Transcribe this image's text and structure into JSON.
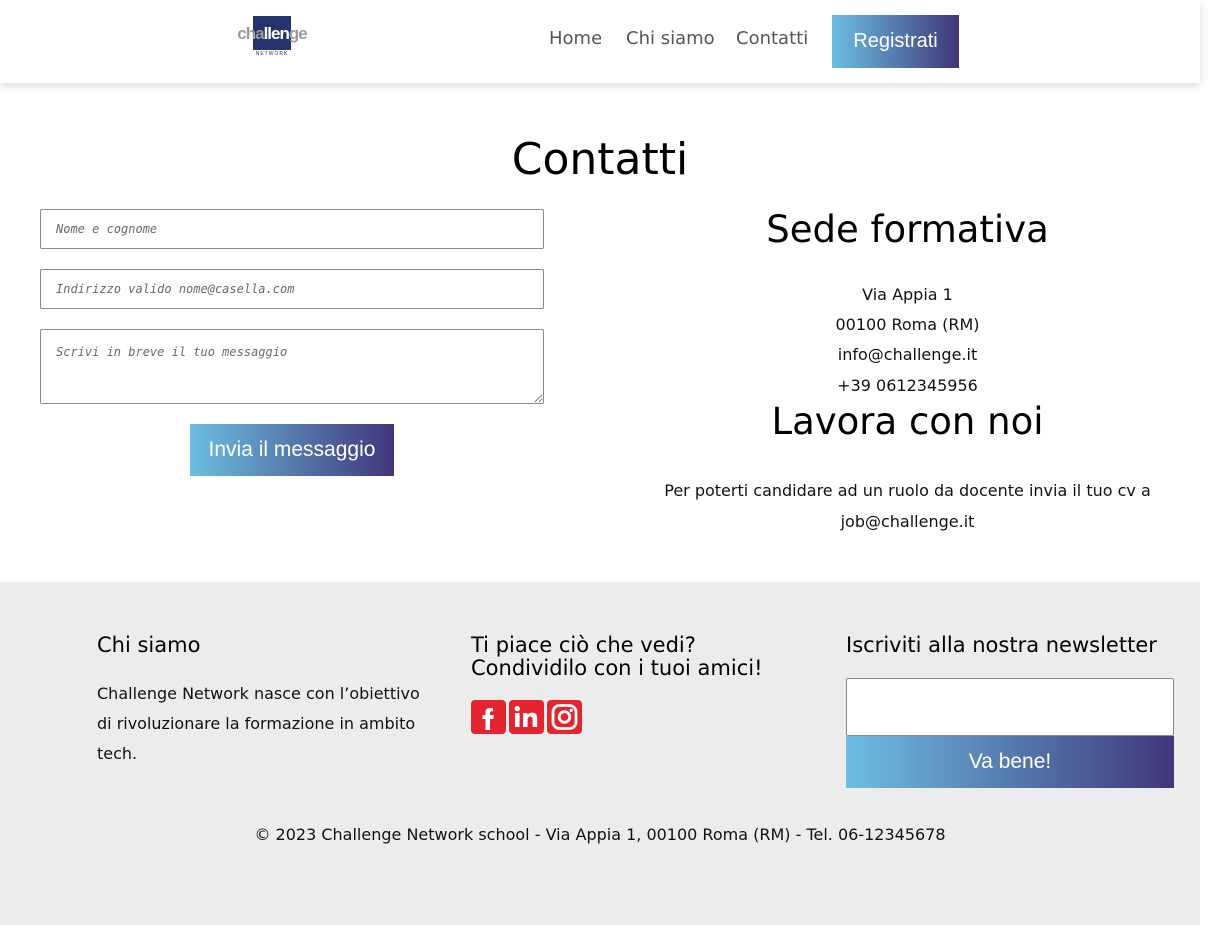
{
  "header": {
    "logo_word_before": "cha",
    "logo_word_box": "llen",
    "logo_word_after": "ge",
    "logo_sub": "NETWORK",
    "nav": [
      {
        "label": "Home"
      },
      {
        "label": "Chi siamo"
      },
      {
        "label": "Contatti"
      }
    ],
    "register_label": "Registrati"
  },
  "main": {
    "title": "Contatti",
    "form": {
      "name_placeholder": "Nome e cognome",
      "email_placeholder": "Indirizzo valido nome@casella.com",
      "message_placeholder": "Scrivi in breve il tuo messaggio",
      "submit_label": "Invia il messaggio"
    },
    "sede": {
      "title": "Sede formativa",
      "lines": [
        "Via Appia 1",
        "00100 Roma (RM)",
        "info@challenge.it",
        "+39 0612345956"
      ]
    },
    "lavora": {
      "title": "Lavora con noi",
      "text": "Per poterti candidare ad un ruolo da docente invia il tuo cv a job@challenge.it"
    }
  },
  "footer": {
    "chi_siamo": {
      "title": "Chi siamo",
      "text": "Challenge Network nasce con l’obiettivo di rivoluzionare la formazione in ambito tech."
    },
    "share": {
      "title_line1": "Ti piace ciò che vedi?",
      "title_line2": "Condividilo con i tuoi amici!",
      "icons": [
        "facebook-icon",
        "linkedin-icon",
        "instagram-icon"
      ]
    },
    "newsletter": {
      "title": "Iscriviti alla nostra newsletter",
      "input_value": "",
      "button_label": "Va bene!"
    },
    "copyright": "© 2023 Challenge Network school - Via Appia 1, 00100 Roma (RM) - Tel. 06-12345678"
  },
  "colors": {
    "brand_navy": "#24336b",
    "gradient_start": "#6cbfe0",
    "gradient_end": "#40367a",
    "social_red": "#e4242f",
    "footer_bg": "#ececec"
  }
}
